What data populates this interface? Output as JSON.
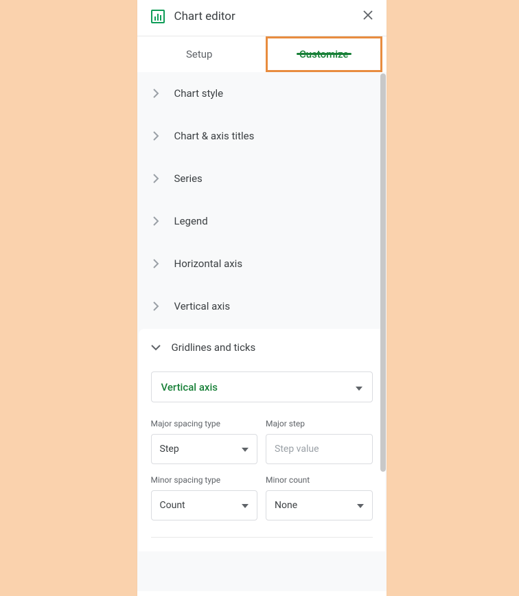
{
  "header": {
    "title": "Chart editor"
  },
  "tabs": {
    "setup": "Setup",
    "customize": "Customize"
  },
  "sections": {
    "chart_style": "Chart style",
    "chart_axis_titles": "Chart & axis titles",
    "series": "Series",
    "legend": "Legend",
    "horizontal_axis": "Horizontal axis",
    "vertical_axis": "Vertical axis",
    "gridlines_ticks": "Gridlines and ticks"
  },
  "gridlines": {
    "axis_select": "Vertical axis",
    "major_spacing_type_label": "Major spacing type",
    "major_spacing_type_value": "Step",
    "major_step_label": "Major step",
    "major_step_placeholder": "Step value",
    "minor_spacing_type_label": "Minor spacing type",
    "minor_spacing_type_value": "Count",
    "minor_count_label": "Minor count",
    "minor_count_value": "None"
  }
}
